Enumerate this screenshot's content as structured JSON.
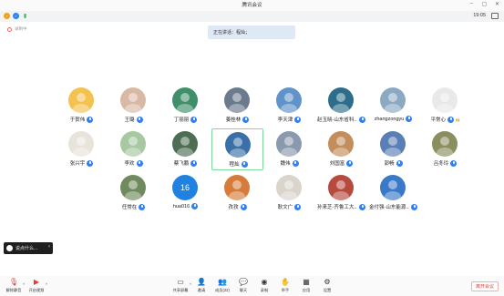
{
  "window": {
    "title": "腾讯会议"
  },
  "status": {
    "time": "19:05",
    "recording_label": "录制中"
  },
  "banner": {
    "speaking_text": "正在讲话：程灿；"
  },
  "participants": [
    {
      "name": "于贺伟",
      "color": "#f3c24f",
      "muted": true
    },
    {
      "name": "王璐",
      "color": "#d9b9a6",
      "muted": true
    },
    {
      "name": "丁丽丽",
      "color": "#3f8f6a",
      "muted": true
    },
    {
      "name": "姜桂林",
      "color": "#6b7a8c",
      "muted": true
    },
    {
      "name": "李天津",
      "color": "#5f93c9",
      "muted": true
    },
    {
      "name": "赵玉晓-山东省科...",
      "color": "#2e6d8a",
      "muted": true
    },
    {
      "name": "zhangzongyu",
      "color": "#8ca9c4",
      "muted": true
    },
    {
      "name": "平常心",
      "color": "#e9e9e9",
      "muted": false,
      "speaking": true
    },
    {
      "name": "张兴宇",
      "color": "#e8e4dc",
      "muted": false
    },
    {
      "name": "李欢",
      "color": "#a7c8a0",
      "muted": true
    },
    {
      "name": "蔡飞鹏",
      "color": "#4d6e52",
      "muted": true
    },
    {
      "name": "程灿",
      "color": "#3b6fa8",
      "muted": true,
      "active": true
    },
    {
      "name": "魏伟",
      "color": "#8a99ad",
      "muted": true
    },
    {
      "name": "刘国富",
      "color": "#c48d5c",
      "muted": true
    },
    {
      "name": "郭畅",
      "color": "#5a7fb4",
      "muted": true
    },
    {
      "name": "吕冬玲",
      "color": "#8b8e5e",
      "muted": true
    },
    {
      "name": "任常在",
      "color": "#6f8a5d",
      "muted": true
    },
    {
      "name": "hua016",
      "color": "#1f82e0",
      "muted": true,
      "initials": "16"
    },
    {
      "name": "孜孜",
      "color": "#d77b3a",
      "muted": true
    },
    {
      "name": "耿文广",
      "color": "#d9d4cc",
      "muted": true
    },
    {
      "name": "孙来芝-齐鲁工大...",
      "color": "#b64a3f",
      "muted": true
    },
    {
      "name": "金付强-山东能源...",
      "color": "#3a78c8",
      "muted": true
    }
  ],
  "chat": {
    "placeholder": "说点什么..."
  },
  "toolbar": {
    "left": [
      {
        "label": "解除静音",
        "icon": "mic-muted-icon"
      },
      {
        "label": "开启视频",
        "icon": "video-off-icon"
      }
    ],
    "center": [
      {
        "label": "共享屏幕",
        "icon": "share-screen-icon"
      },
      {
        "label": "邀请",
        "icon": "invite-icon"
      },
      {
        "label": "成员(22)",
        "icon": "members-icon"
      },
      {
        "label": "聊天",
        "icon": "chat-icon"
      },
      {
        "label": "录制",
        "icon": "record-icon"
      },
      {
        "label": "举手",
        "icon": "raise-hand-icon"
      },
      {
        "label": "应用",
        "icon": "apps-icon"
      },
      {
        "label": "设置",
        "icon": "settings-icon"
      }
    ],
    "leave_label": "离开会议"
  },
  "colors": {
    "accent": "#2f7ff5",
    "leave": "#e03a3a",
    "active_border": "#7bd99a"
  }
}
